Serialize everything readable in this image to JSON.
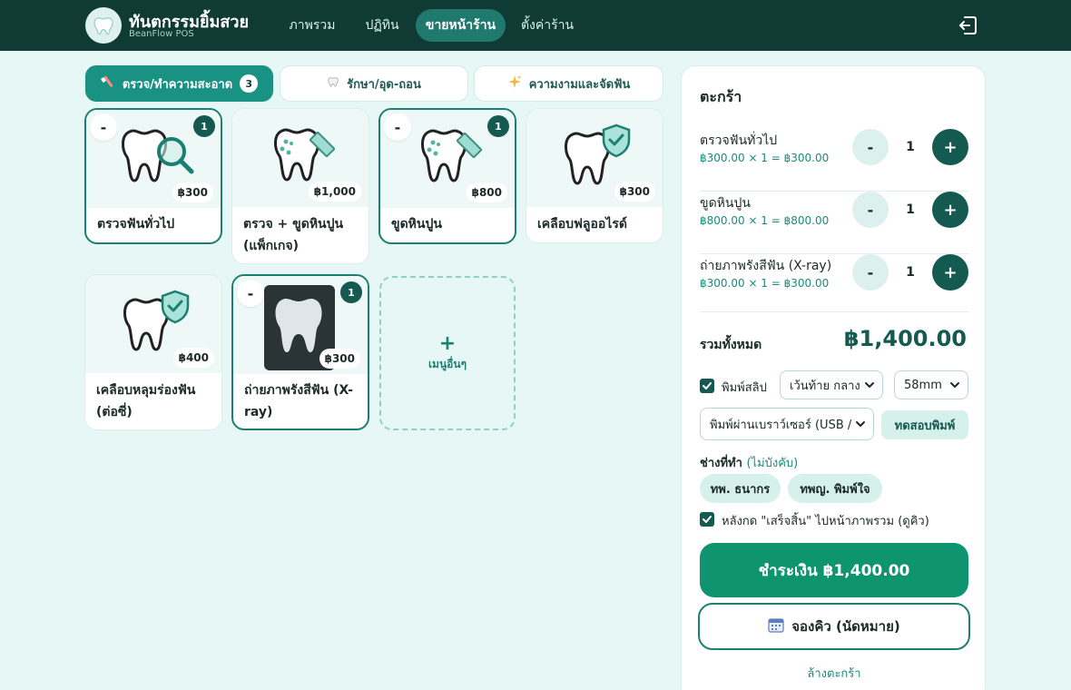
{
  "brand": {
    "name": "ทันตกรรมยิ้มสวย",
    "subtitle": "BeanFlow POS",
    "logo_icon": "tooth-icon"
  },
  "nav": {
    "items": [
      {
        "label": "ภาพรวม",
        "active": false
      },
      {
        "label": "ปฏิทิน",
        "active": false
      },
      {
        "label": "ขายหน้าร้าน",
        "active": true
      },
      {
        "label": "ตั้งค่าร้าน",
        "active": false
      }
    ],
    "logout_icon": "logout-icon"
  },
  "categories": [
    {
      "label": "ตรวจ/ทำความสะอาด",
      "icon": "toothbrush-icon",
      "badge": "3",
      "active": true
    },
    {
      "label": "รักษา/อุด-ถอน",
      "icon": "tooth-icon",
      "active": false
    },
    {
      "label": "ความงามและจัดฟัน",
      "icon": "sparkles-icon",
      "active": false
    }
  ],
  "products": [
    {
      "name": "ตรวจฟันทั่วไป",
      "price": "฿300",
      "qty": "1",
      "minus": "-",
      "icon": "tooth-magnifier-icon",
      "selected": true
    },
    {
      "name": "ตรวจ + ขูดหินปูน (แพ็กเกจ)",
      "price": "฿1,000",
      "icon": "tooth-scaler-icon",
      "selected": false
    },
    {
      "name": "ขูดหินปูน",
      "price": "฿800",
      "qty": "1",
      "minus": "-",
      "icon": "tooth-scaler-icon",
      "selected": true
    },
    {
      "name": "เคลือบฟลูออไรด์",
      "price": "฿300",
      "icon": "tooth-shield-icon",
      "selected": false
    },
    {
      "name": "เคลือบหลุมร่องฟัน (ต่อซี่)",
      "price": "฿400",
      "icon": "tooth-shield-icon",
      "selected": false
    },
    {
      "name": "ถ่ายภาพรังสีฟัน (X-ray)",
      "price": "฿300",
      "qty": "1",
      "minus": "-",
      "icon": "xray-tooth-icon",
      "selected": true
    }
  ],
  "more_menu": {
    "plus": "+",
    "label": "เมนูอื่นๆ"
  },
  "cart": {
    "title": "ตะกร้า",
    "items": [
      {
        "name": "ตรวจฟันทั่วไป",
        "calc": "฿300.00 × 1 = ฿300.00",
        "qty": "1"
      },
      {
        "name": "ขูดหินปูน",
        "calc": "฿800.00 × 1 = ฿800.00",
        "qty": "1"
      },
      {
        "name": "ถ่ายภาพรังสีฟัน (X-ray)",
        "calc": "฿300.00 × 1 = ฿300.00",
        "qty": "1"
      }
    ],
    "minus_label": "-",
    "plus_label": "+",
    "total_label": "รวมทั้งหมด",
    "total_value": "฿1,400.00",
    "print_slip_label": "พิมพ์สลิป",
    "print_slip_checked": true,
    "margin_select": "เว้นท้าย กลาง",
    "paper_select": "58mm",
    "printer_select": "พิมพ์ผ่านเบราว์เซอร์ (USB /",
    "test_print_label": "ทดสอบพิมพ์",
    "staff_label": "ช่างที่ทำ",
    "staff_optional": "(ไม่บังคับ)",
    "staff": [
      "ทพ. ธนากร",
      "ทพญ. พิมพ์ใจ"
    ],
    "redirect_label": "หลังกด \"เสร็จสิ้น\" ไปหน้าภาพรวม (ดูคิว)",
    "redirect_checked": true,
    "pay_label": "ชำระเงิน ฿1,400.00",
    "book_label": "จองคิว (นัดหมาย)",
    "book_icon": "calendar-icon",
    "clear_label": "ล้างตะกร้า"
  },
  "colors": {
    "topbar": "#0f3b34",
    "accent": "#199283",
    "dark_green": "#145a50",
    "pay_button": "#0f9470",
    "background": "#e6f7f6"
  }
}
